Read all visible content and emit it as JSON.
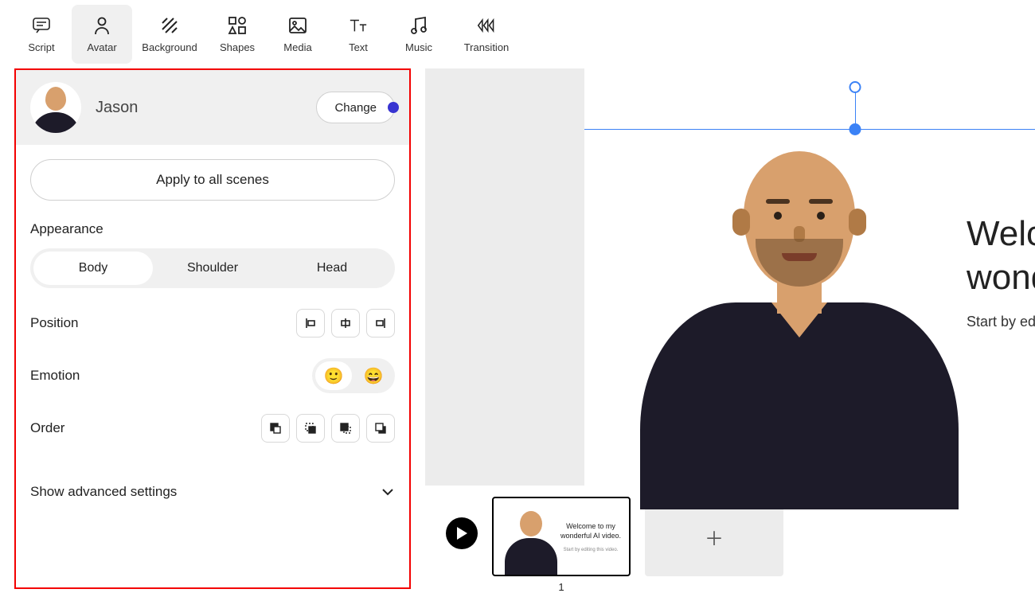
{
  "toolbar": {
    "items": [
      {
        "label": "Script"
      },
      {
        "label": "Avatar"
      },
      {
        "label": "Background"
      },
      {
        "label": "Shapes"
      },
      {
        "label": "Media"
      },
      {
        "label": "Text"
      },
      {
        "label": "Music"
      },
      {
        "label": "Transition"
      }
    ],
    "active": "Avatar"
  },
  "avatar_panel": {
    "name": "Jason",
    "change": "Change",
    "apply_all": "Apply to all scenes",
    "appearance_label": "Appearance",
    "appearance": {
      "options": [
        "Body",
        "Shoulder",
        "Head"
      ],
      "selected": "Body"
    },
    "position_label": "Position",
    "emotion_label": "Emotion",
    "order_label": "Order",
    "advanced": "Show advanced settings"
  },
  "slide": {
    "headline": "Welcome to my wonderful AI video.",
    "sub": "Start by editing this video."
  },
  "timeline": {
    "thumb_headline": "Welcome to my wonderful AI video.",
    "thumb_sub": "Start by editing this video.",
    "index": "1"
  }
}
